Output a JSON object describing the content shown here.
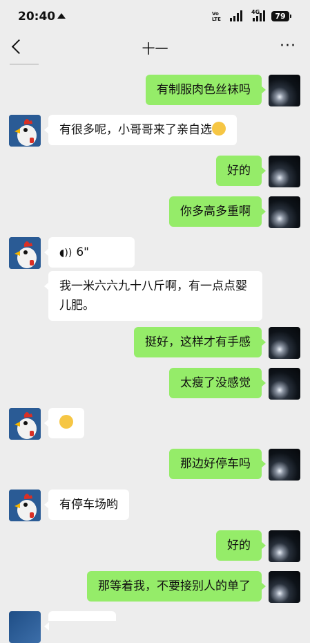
{
  "status_bar": {
    "time": "20:40",
    "volte": "Vo\nLTE",
    "network": "4G",
    "battery": "79"
  },
  "header": {
    "title": "十一",
    "more": "···"
  },
  "messages": [
    {
      "from": "me",
      "text": "有制服肉色丝袜吗"
    },
    {
      "from": "other",
      "text": "有很多呢，小哥哥来了亲自选"
    },
    {
      "from": "me",
      "text": "好的"
    },
    {
      "from": "me",
      "text": "你多高多重啊"
    },
    {
      "from": "other",
      "text": "6\""
    },
    {
      "from": "other",
      "text": "我一米六六九十八斤啊，有一点点婴儿肥。"
    },
    {
      "from": "me",
      "text": "挺好，这样才有手感"
    },
    {
      "from": "me",
      "text": "太瘦了没感觉"
    },
    {
      "from": "me",
      "text": "那边好停车吗"
    },
    {
      "from": "other",
      "text": "有停车场哟"
    },
    {
      "from": "me",
      "text": "好的"
    },
    {
      "from": "me",
      "text": "那等着我，不要接别人的单了"
    }
  ]
}
